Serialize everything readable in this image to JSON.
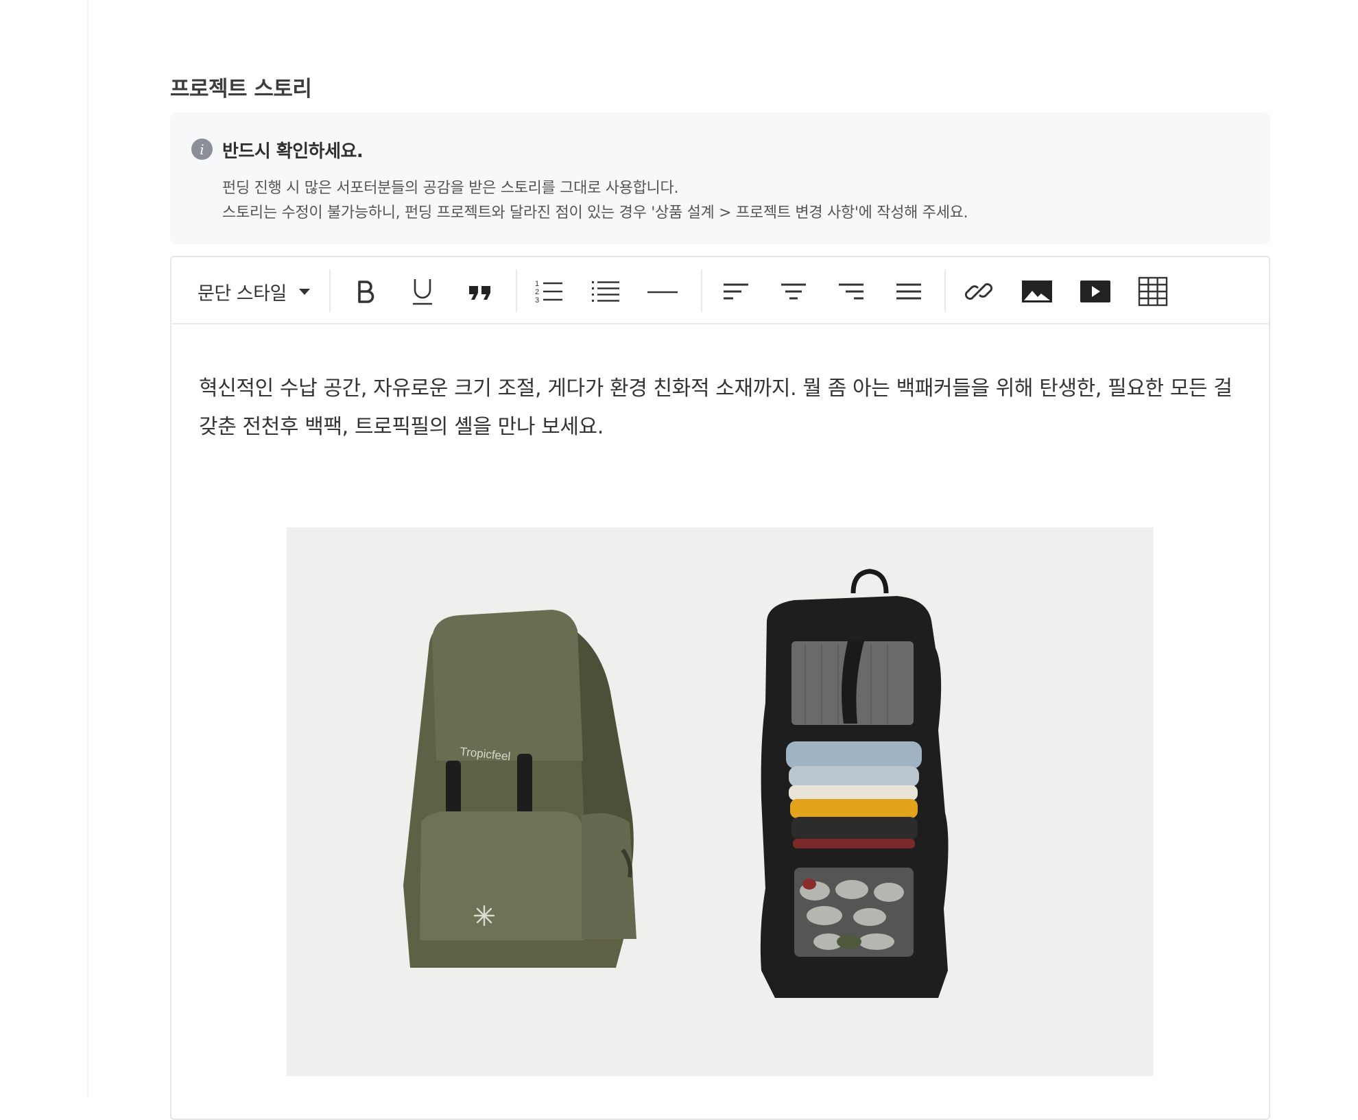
{
  "section": {
    "title": "프로젝트 스토리"
  },
  "notice": {
    "icon": "info-icon",
    "title": "반드시 확인하세요.",
    "lines": [
      "펀딩 진행 시 많은 서포터분들의 공감을 받은 스토리를 그대로 사용합니다.",
      "스토리는 수정이 불가능하니, 펀딩 프로젝트와 달라진 점이 있는 경우 '상품 설계 > 프로젝트 변경 사항'에 작성해 주세요."
    ]
  },
  "toolbar": {
    "style_label": "문단 스타일",
    "buttons": [
      "bold-icon",
      "underline-icon",
      "quote-icon",
      "ordered-list-icon",
      "bullet-list-icon",
      "horizontal-rule-icon",
      "align-left-icon",
      "align-center-icon",
      "align-right-icon",
      "align-justify-icon",
      "link-icon",
      "image-icon",
      "video-icon",
      "table-icon"
    ]
  },
  "content": {
    "paragraph": "혁신적인 수납 공간, 자유로운 크기 조절,  게다가 환경 친화적 소재까지. 뭘 좀 아는 백패커들을 위해 탄생한, 필요한 모든 걸 갖춘 전천후 백팩, 트로픽필의 셸을 만나 보세요.",
    "image": {
      "description_icons": [
        "olive-backpack",
        "black-backpack-open"
      ],
      "brand_text": "Tropicfeel"
    }
  },
  "colors": {
    "olive": "#5f6147",
    "black_bag": "#1e1e1f",
    "notice_bg": "#f7f8fa",
    "icon": "#333333"
  }
}
